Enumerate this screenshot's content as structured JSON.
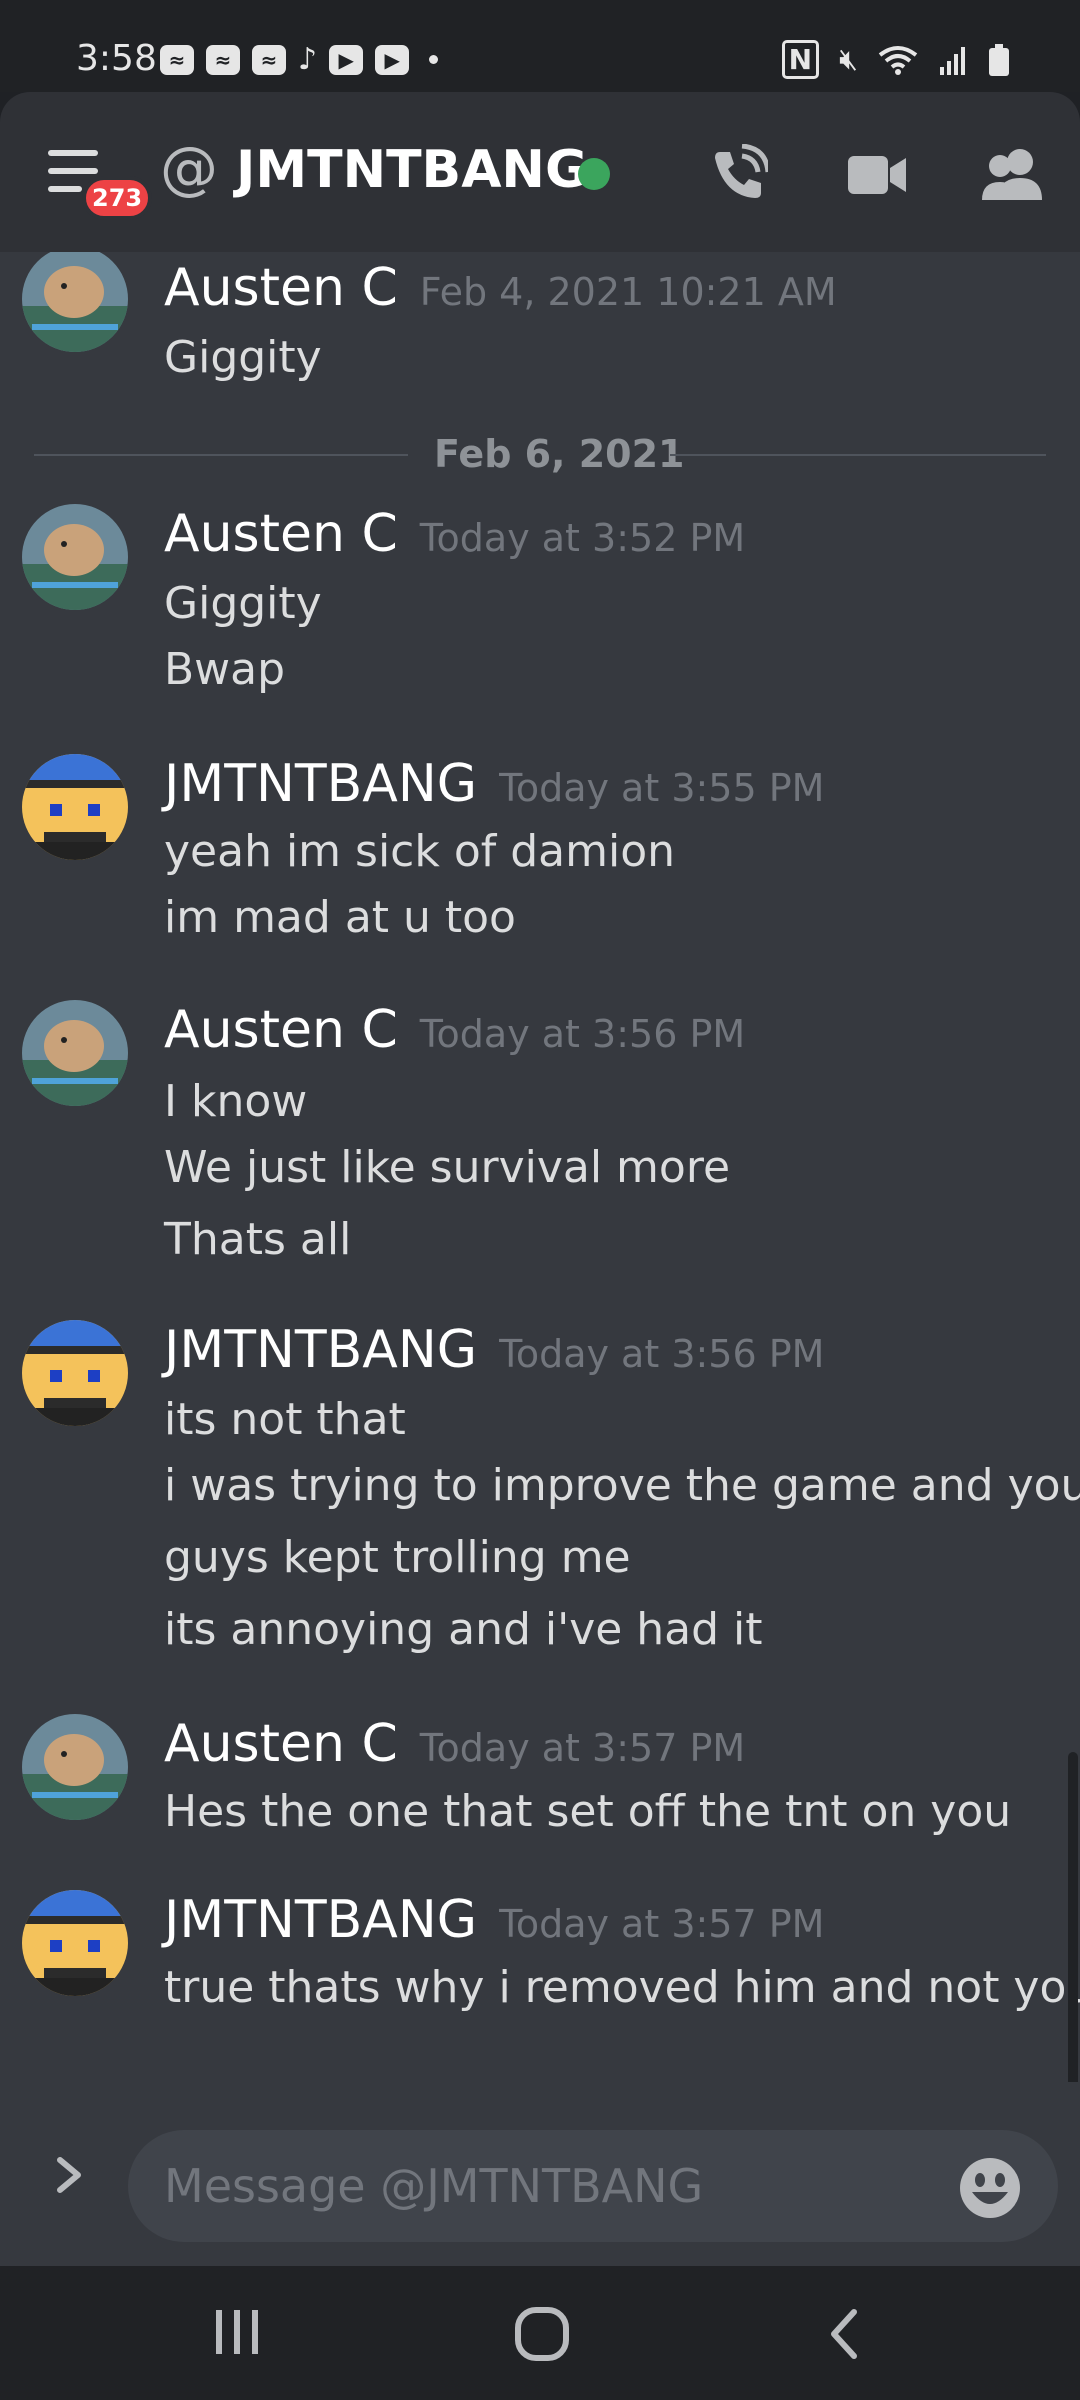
{
  "status_bar": {
    "time": "3:58",
    "left_icons": [
      "messenger-icon",
      "messenger-icon",
      "messenger-icon",
      "tiktok-icon",
      "youtube-icon",
      "youtube-icon",
      "more-dot"
    ],
    "right_icons": [
      "nfc-icon",
      "mute-icon",
      "wifi-icon",
      "signal-icon",
      "battery-icon"
    ]
  },
  "header": {
    "badge": "273",
    "at_symbol": "@",
    "title": "JMTNTBANG",
    "online": true,
    "colors": {
      "online": "#3ba55d",
      "badge": "#ed4245"
    }
  },
  "messages": [
    {
      "author": "Austen C",
      "timestamp": "Feb 4, 2021 10:21 AM",
      "lines": [
        "Giggity"
      ],
      "avatar": "hamster-avatar"
    },
    {
      "author": "Austen C",
      "timestamp": "Today at 3:52 PM",
      "lines": [
        "Giggity",
        "Bwap"
      ],
      "avatar": "hamster-avatar"
    },
    {
      "author": "JMTNTBANG",
      "timestamp": "Today at 3:55 PM",
      "lines": [
        "yeah im sick of damion",
        "im mad at u too"
      ],
      "avatar": "pixel-face-avatar"
    },
    {
      "author": "Austen C",
      "timestamp": "Today at 3:56 PM",
      "lines": [
        "I know",
        "We just like survival more",
        "Thats all"
      ],
      "avatar": "hamster-avatar"
    },
    {
      "author": "JMTNTBANG",
      "timestamp": "Today at 3:56 PM",
      "lines": [
        "its not that",
        "i was trying to improve the game and you",
        "guys kept trolling me",
        "its annoying and i've had it"
      ],
      "avatar": "pixel-face-avatar"
    },
    {
      "author": "Austen C",
      "timestamp": "Today at 3:57 PM",
      "lines": [
        "Hes the one that set off the tnt on you"
      ],
      "avatar": "hamster-avatar"
    },
    {
      "author": "JMTNTBANG",
      "timestamp": "Today at 3:57 PM",
      "lines": [
        "true thats why i removed him and not you"
      ],
      "avatar": "pixel-face-avatar"
    }
  ],
  "date_divider": "Feb 6, 2021",
  "composer": {
    "placeholder": "Message @JMTNTBANG"
  }
}
